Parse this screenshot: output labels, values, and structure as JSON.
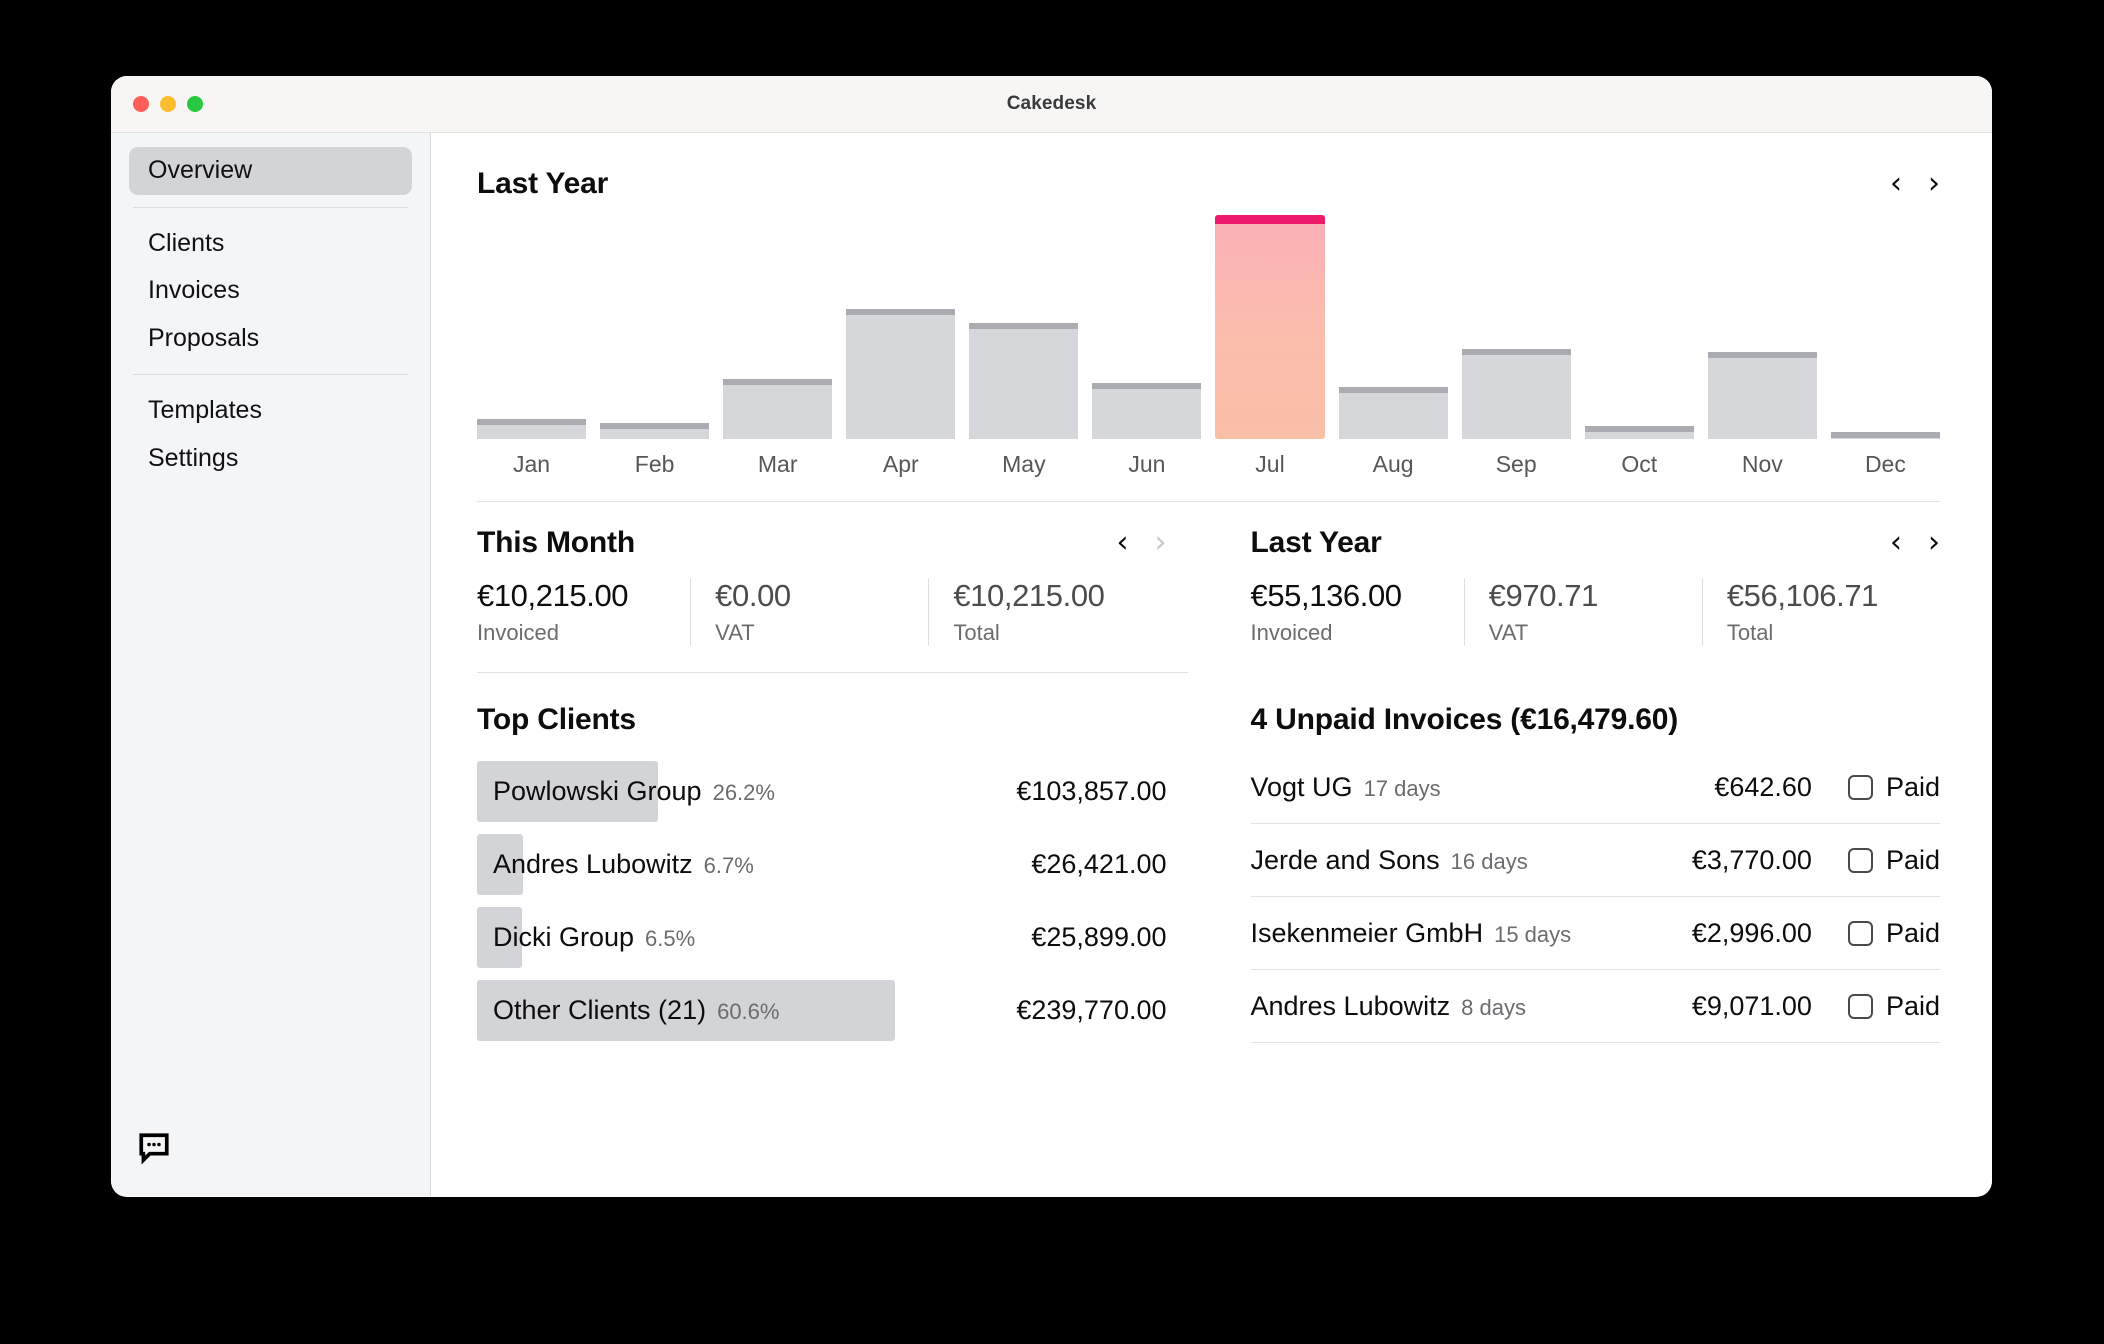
{
  "window": {
    "title": "Cakedesk",
    "traffic_lights": [
      "close",
      "minimize",
      "maximize"
    ]
  },
  "sidebar": {
    "groups": [
      {
        "items": [
          {
            "label": "Overview",
            "active": true
          }
        ]
      },
      {
        "items": [
          {
            "label": "Clients",
            "active": false
          },
          {
            "label": "Invoices",
            "active": false
          },
          {
            "label": "Proposals",
            "active": false
          }
        ]
      },
      {
        "items": [
          {
            "label": "Templates",
            "active": false
          },
          {
            "label": "Settings",
            "active": false
          }
        ]
      }
    ],
    "footer_icon": "chat-bubble-icon"
  },
  "chart_section": {
    "title": "Last Year",
    "prev_label": "‹",
    "next_label": "›"
  },
  "chart_data": {
    "type": "bar",
    "title": "Last Year",
    "xlabel": "",
    "ylabel": "",
    "categories": [
      "Jan",
      "Feb",
      "Mar",
      "Apr",
      "May",
      "Jun",
      "Jul",
      "Aug",
      "Sep",
      "Oct",
      "Nov",
      "Dec"
    ],
    "values": [
      9,
      7,
      27,
      58,
      52,
      25,
      100,
      23,
      40,
      6,
      39,
      3
    ],
    "ylim": [
      0,
      100
    ],
    "grid": false,
    "legend": null,
    "highlight_index": 6,
    "highlight_label": "Jul",
    "bar_color": "#d6d7da",
    "bar_cap_color": "#aaacb1",
    "highlight_cap_color": "#ec1a68",
    "highlight_gradient_top": "#fbb0b6",
    "highlight_gradient_bottom": "#f9bfa7"
  },
  "this_month": {
    "title": "This Month",
    "prev_label": "‹",
    "next_label": "›",
    "next_disabled": true,
    "stats": [
      {
        "value": "€10,215.00",
        "label": "Invoiced",
        "muted": false
      },
      {
        "value": "€0.00",
        "label": "VAT",
        "muted": true
      },
      {
        "value": "€10,215.00",
        "label": "Total",
        "muted": true
      }
    ]
  },
  "last_year": {
    "title": "Last Year",
    "prev_label": "‹",
    "next_label": "›",
    "next_disabled": false,
    "stats": [
      {
        "value": "€55,136.00",
        "label": "Invoiced",
        "muted": false
      },
      {
        "value": "€970.71",
        "label": "VAT",
        "muted": true
      },
      {
        "value": "€56,106.71",
        "label": "Total",
        "muted": true
      }
    ]
  },
  "top_clients": {
    "title": "Top Clients",
    "rows": [
      {
        "name": "Powlowski Group",
        "pct": "26.2%",
        "amount": "€103,857.00",
        "bar_width": "26.2%"
      },
      {
        "name": "Andres Lubowitz",
        "pct": "6.7%",
        "amount": "€26,421.00",
        "bar_width": "6.7%"
      },
      {
        "name": "Dicki Group",
        "pct": "6.5%",
        "amount": "€25,899.00",
        "bar_width": "6.5%"
      },
      {
        "name": "Other Clients (21)",
        "pct": "60.6%",
        "amount": "€239,770.00",
        "bar_width": "60.6%"
      }
    ]
  },
  "unpaid_invoices": {
    "title": "4 Unpaid Invoices (€16,479.60)",
    "count": 4,
    "total": "€16,479.60",
    "paid_label": "Paid",
    "rows": [
      {
        "client": "Vogt UG",
        "days": "17 days",
        "amount": "€642.60",
        "paid": false
      },
      {
        "client": "Jerde and Sons",
        "days": "16 days",
        "amount": "€3,770.00",
        "paid": false
      },
      {
        "client": "Isekenmeier GmbH",
        "days": "15 days",
        "amount": "€2,996.00",
        "paid": false
      },
      {
        "client": "Andres Lubowitz",
        "days": "8 days",
        "amount": "€9,071.00",
        "paid": false
      }
    ]
  }
}
